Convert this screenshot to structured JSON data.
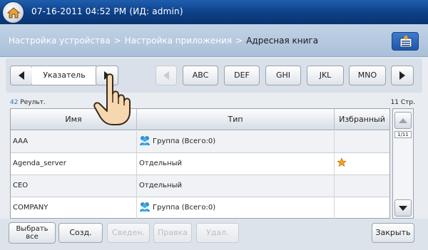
{
  "status": {
    "datetime_user": "07-16-2011 04:52 PM (ИД: admin)"
  },
  "breadcrumb": {
    "items": [
      "Настройка устройства",
      "Настройка приложения"
    ],
    "current": "Адресная книга"
  },
  "nav": {
    "index_label": "Указатель",
    "groups": [
      "ABC",
      "DEF",
      "GHI",
      "JKL",
      "MNO"
    ]
  },
  "results": {
    "count": "42",
    "count_label": "Реульт.",
    "pages": "11 Стр."
  },
  "table": {
    "headers": {
      "name": "Имя",
      "type": "Тип",
      "favorite": "Избранный"
    },
    "rows": [
      {
        "name": "AAA",
        "type": "Группа (Всего:0)",
        "is_group": true,
        "favorite": false
      },
      {
        "name": "Agenda_server",
        "type": "Отдельный",
        "is_group": false,
        "favorite": true
      },
      {
        "name": "CEO",
        "type": "Отдельный",
        "is_group": false,
        "favorite": false
      },
      {
        "name": "COMPANY",
        "type": "Группа (Всего:0)",
        "is_group": true,
        "favorite": false
      }
    ]
  },
  "scroll": {
    "page_indicator": "1/11"
  },
  "toolbar": {
    "select_all_line1": "Выбрать",
    "select_all_line2": "все",
    "create": "Созд.",
    "details": "Сведен.",
    "edit": "Правка",
    "delete": "Удал.",
    "close": "Закрыть"
  },
  "colors": {
    "accent": "#1f5eae",
    "star": "#f0a020",
    "results_count": "#3a78c2"
  },
  "icons": [
    "home-icon",
    "address-book-icon",
    "group-icon",
    "favorite-star-icon",
    "pointer-hand-icon"
  ]
}
